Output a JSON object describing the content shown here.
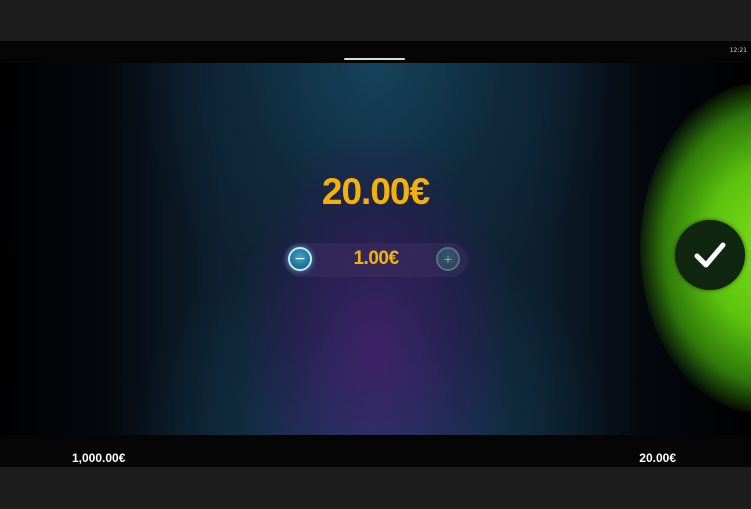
{
  "status_bar": {
    "time": "12:21"
  },
  "bet_panel": {
    "total_bet": "20.00€",
    "coin_value": "1.00€",
    "minus_glyph": "−",
    "plus_glyph": "+"
  },
  "confirm": {
    "icon": "checkmark-icon"
  },
  "footer": {
    "balance": "1,000.00€",
    "bet": "20.00€"
  },
  "colors": {
    "accent_gold": "#f5b10a",
    "confirm_green": "#7ee017",
    "minus_button": "#3fa4c8"
  }
}
